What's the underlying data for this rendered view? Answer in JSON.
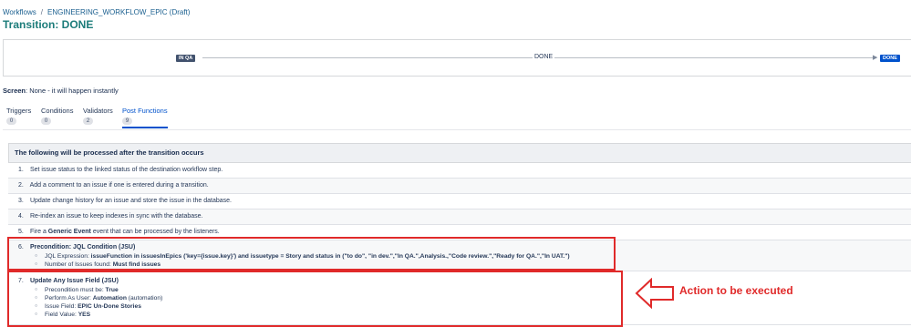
{
  "breadcrumb": {
    "root": "Workflows",
    "separator": "/",
    "workflow": "ENGINEERING_WORKFLOW_EPIC (Draft)"
  },
  "title": "Transition: DONE",
  "diagram": {
    "from_status": "IN QA",
    "transition": "DONE",
    "to_status": "DONE"
  },
  "screen": {
    "label": "Screen",
    "value": ": None - it will happen instantly"
  },
  "tabs": [
    {
      "label": "Triggers",
      "count": "0"
    },
    {
      "label": "Conditions",
      "count": "0"
    },
    {
      "label": "Validators",
      "count": "2"
    },
    {
      "label": "Post Functions",
      "count": "9"
    }
  ],
  "post_functions": {
    "header": "The following will be processed after the transition occurs",
    "items": [
      {
        "num": "1.",
        "text": "Set issue status to the linked status of the destination workflow step."
      },
      {
        "num": "2.",
        "text": "Add a comment to an issue if one is entered during a transition."
      },
      {
        "num": "3.",
        "text": "Update change history for an issue and store the issue in the database."
      },
      {
        "num": "4.",
        "text": "Re-index an issue to keep indexes in sync with the database."
      },
      {
        "num": "5.",
        "text_before": "Fire a ",
        "text_bold": "Generic Event",
        "text_after": " event that can be processed by the listeners."
      }
    ],
    "item6": {
      "num": "6.",
      "title": "Precondition: JQL Condition (JSU)",
      "jql_label": "JQL Expression: ",
      "jql_value": "issueFunction in issuesInEpics ('key={issue.key}') and issuetype = Story and status in (\"to do\", \"in dev.\",\"In QA.\",Analysis.,\"Code review.\",\"Ready for QA.\",\"In UAT.\")",
      "issues_label": "Number of Issues found: ",
      "issues_value": "Must find issues"
    },
    "item7": {
      "num": "7.",
      "title": "Update Any Issue Field (JSU)",
      "precondition_label": "Precondition must be: ",
      "precondition_value": "True",
      "perform_label": "Perform As User: ",
      "perform_value": "Automation",
      "perform_suffix": " (automation)",
      "field_label": "Issue Field: ",
      "field_value": "EPIC Un-Done Stories",
      "value_label": "Field Value: ",
      "value_value": "YES"
    }
  },
  "annotation": {
    "text": "Action to be executed",
    "color": "#e02a2a"
  }
}
